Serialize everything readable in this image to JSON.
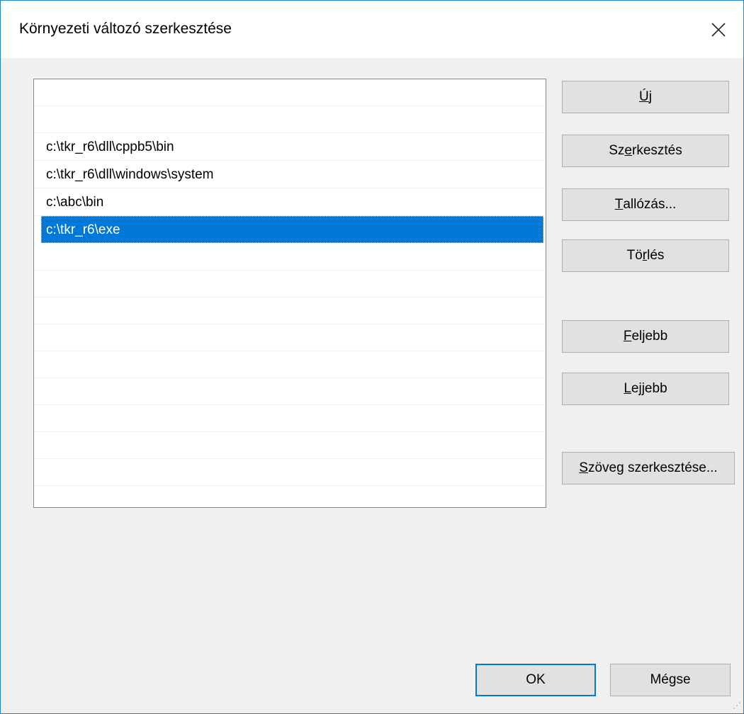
{
  "window": {
    "title": "Környezeti változó szerkesztése",
    "close_icon": "close-icon"
  },
  "path_list": {
    "items": [
      "",
      "",
      "c:\\tkr_r6\\dll\\cppb5\\bin",
      "c:\\tkr_r6\\dll\\windows\\system",
      "c:\\abc\\bin",
      "c:\\tkr_r6\\exe"
    ],
    "selected_index": 5,
    "selection_color": "#0078d7"
  },
  "buttons": {
    "new": {
      "pre": "",
      "mnemonic": "Ú",
      "post": "j"
    },
    "edit": {
      "pre": "Sz",
      "mnemonic": "e",
      "post": "rkesztés"
    },
    "browse": {
      "pre": "",
      "mnemonic": "T",
      "post": "allózás..."
    },
    "delete": {
      "pre": "Tö",
      "mnemonic": "r",
      "post": "lés"
    },
    "up": {
      "pre": "",
      "mnemonic": "F",
      "post": "eljebb"
    },
    "down": {
      "pre": "",
      "mnemonic": "L",
      "post": "ejjebb"
    },
    "edit_text": {
      "pre": "",
      "mnemonic": "S",
      "post": "zöveg szerkesztése..."
    },
    "ok": "OK",
    "cancel": "Mégse"
  }
}
